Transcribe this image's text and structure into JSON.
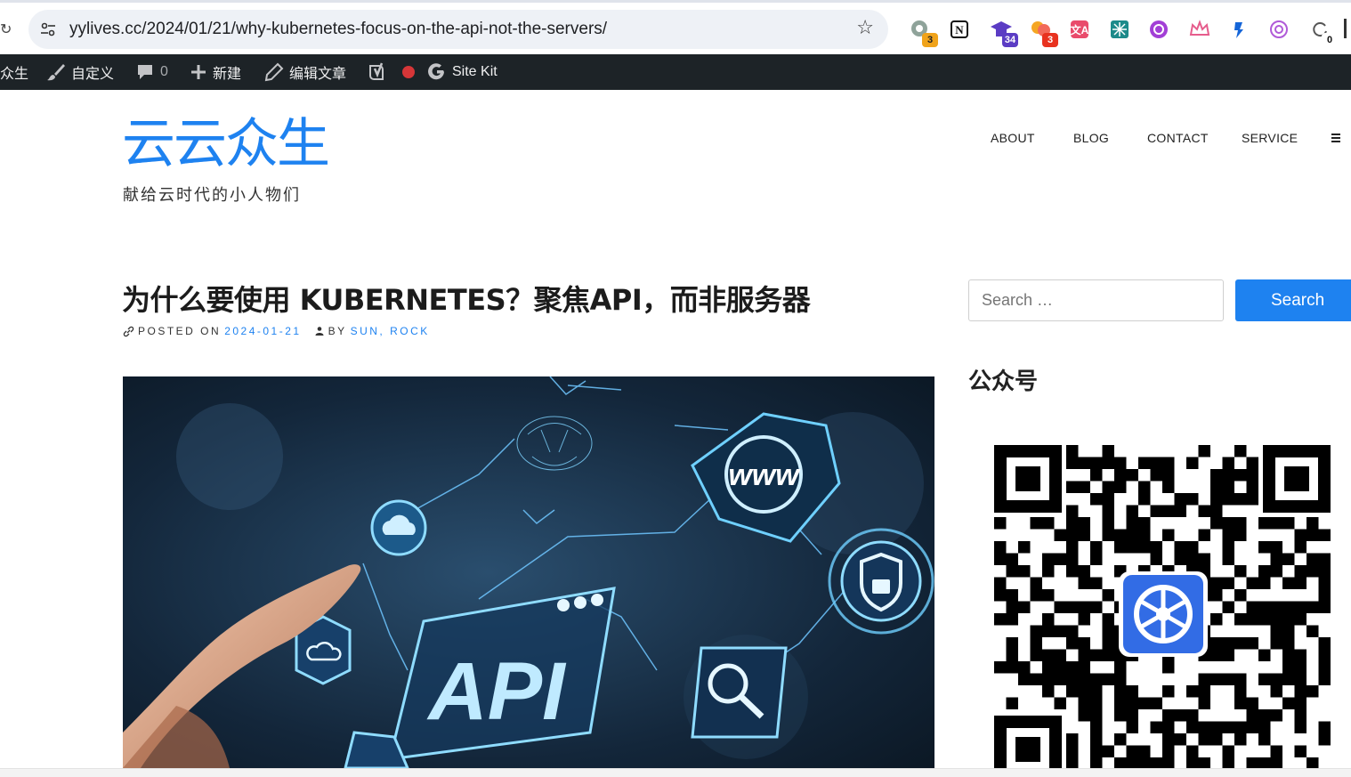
{
  "browser": {
    "url": "yylives.cc/2024/01/21/why-kubernetes-focus-on-the-api-not-the-servers/",
    "extensions": [
      {
        "name": "chatgpt-ext-icon",
        "badge": "3",
        "badge_color": "#f0a31a"
      },
      {
        "name": "notion-icon",
        "badge": ""
      },
      {
        "name": "graduation-cap-icon",
        "badge": "34",
        "badge_color": "#5b3cc4"
      },
      {
        "name": "bubbles-icon",
        "badge": "3",
        "badge_color": "#e8321f"
      },
      {
        "name": "translate-icon",
        "badge": ""
      },
      {
        "name": "grid-glyph-icon",
        "badge": ""
      },
      {
        "name": "purple-swirl-icon",
        "badge": ""
      },
      {
        "name": "crown-icon",
        "badge": ""
      },
      {
        "name": "blue-pin-icon",
        "badge": ""
      },
      {
        "name": "openai-icon",
        "badge": ""
      },
      {
        "name": "refresh-counter-icon",
        "badge": "0",
        "badge_color": "#ffffff"
      }
    ]
  },
  "admin_bar": {
    "site": "众生",
    "customize": "自定义",
    "comments": "0",
    "new": "新建",
    "edit": "编辑文章",
    "site_kit": "Site Kit"
  },
  "header": {
    "site_title": "云云众生",
    "tagline": "献给云时代的小人物们",
    "nav": [
      "ABOUT",
      "BLOG",
      "CONTACT",
      "SERVICE"
    ]
  },
  "post": {
    "title": "为什么要使用 KUBERNETES？聚焦API，而非服务器",
    "posted_on_label": "POSTED ON",
    "date": "2024-01-21",
    "by_label": "BY",
    "author": "SUN, ROCK",
    "image_label": "API"
  },
  "sidebar": {
    "search_placeholder": "Search …",
    "search_button": "Search",
    "widget_title": "公众号"
  },
  "colors": {
    "accent": "#1e82f0",
    "admin_bar": "#1d2327"
  }
}
